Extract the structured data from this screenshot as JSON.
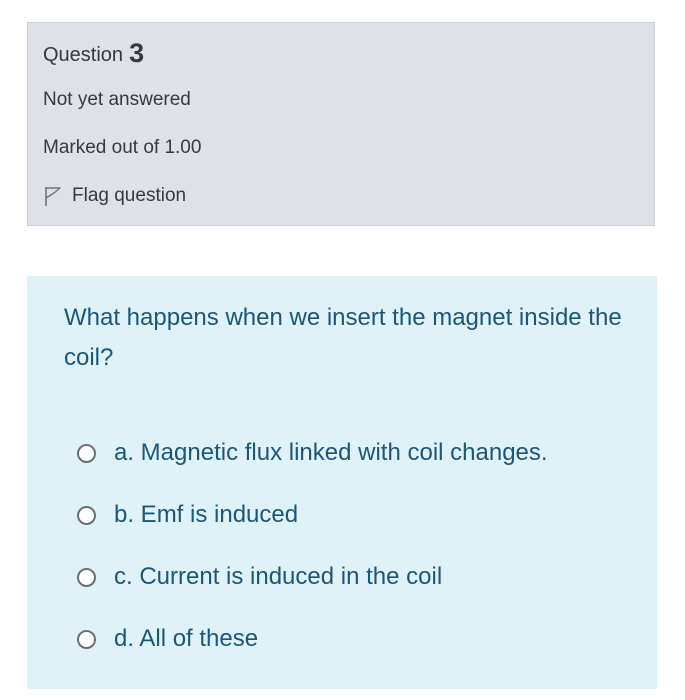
{
  "info": {
    "question_label": "Question",
    "question_number": "3",
    "state": "Not yet answered",
    "grade": "Marked out of 1.00",
    "flag_label": "Flag question"
  },
  "question": {
    "text": "What happens when we insert the magnet inside the coil?",
    "answers": [
      "a. Magnetic flux linked with coil changes.",
      "b. Emf is induced",
      "c. Current is induced in the coil",
      "d. All of these"
    ]
  },
  "colors": {
    "info_background": "#dee2e6",
    "content_background": "#def2f8",
    "question_text": "#1d5775"
  },
  "icons": {
    "flag": "flag-outline-icon",
    "option": "radio-unselected"
  }
}
